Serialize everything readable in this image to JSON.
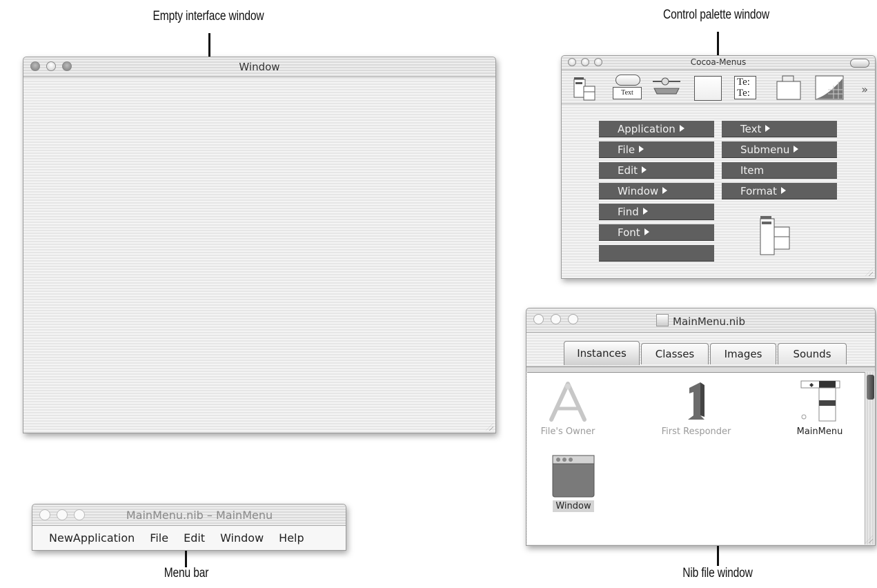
{
  "callouts": {
    "empty_window": "Empty interface window",
    "palette_window": "Control palette window",
    "menu_bar": "Menu bar",
    "nib_window": "Nib file window"
  },
  "empty_window": {
    "title": "Window"
  },
  "palette_window": {
    "title": "Cocoa-Menus",
    "toolbar": {
      "text_button_label": "Text",
      "text_field_lines": [
        "Te:",
        "Te:"
      ],
      "more_glyph": "»"
    },
    "menus_left": [
      "Application",
      "File",
      "Edit",
      "Window",
      "Find",
      "Font",
      ""
    ],
    "menus_left_has_submenu": [
      true,
      true,
      true,
      true,
      true,
      true,
      false
    ],
    "menus_right": [
      "Text",
      "Submenu",
      "Item",
      "Format"
    ],
    "menus_right_has_submenu": [
      true,
      true,
      false,
      true
    ]
  },
  "nib_window": {
    "title": "MainMenu.nib",
    "tabs": [
      "Instances",
      "Classes",
      "Images",
      "Sounds"
    ],
    "active_tab": "Instances",
    "icons": [
      {
        "label": "File's Owner"
      },
      {
        "label": "First Responder"
      },
      {
        "label": "MainMenu"
      },
      {
        "label": "Window"
      }
    ]
  },
  "menubar_window": {
    "title": "MainMenu.nib – MainMenu",
    "items": [
      "NewApplication",
      "File",
      "Edit",
      "Window",
      "Help"
    ]
  }
}
